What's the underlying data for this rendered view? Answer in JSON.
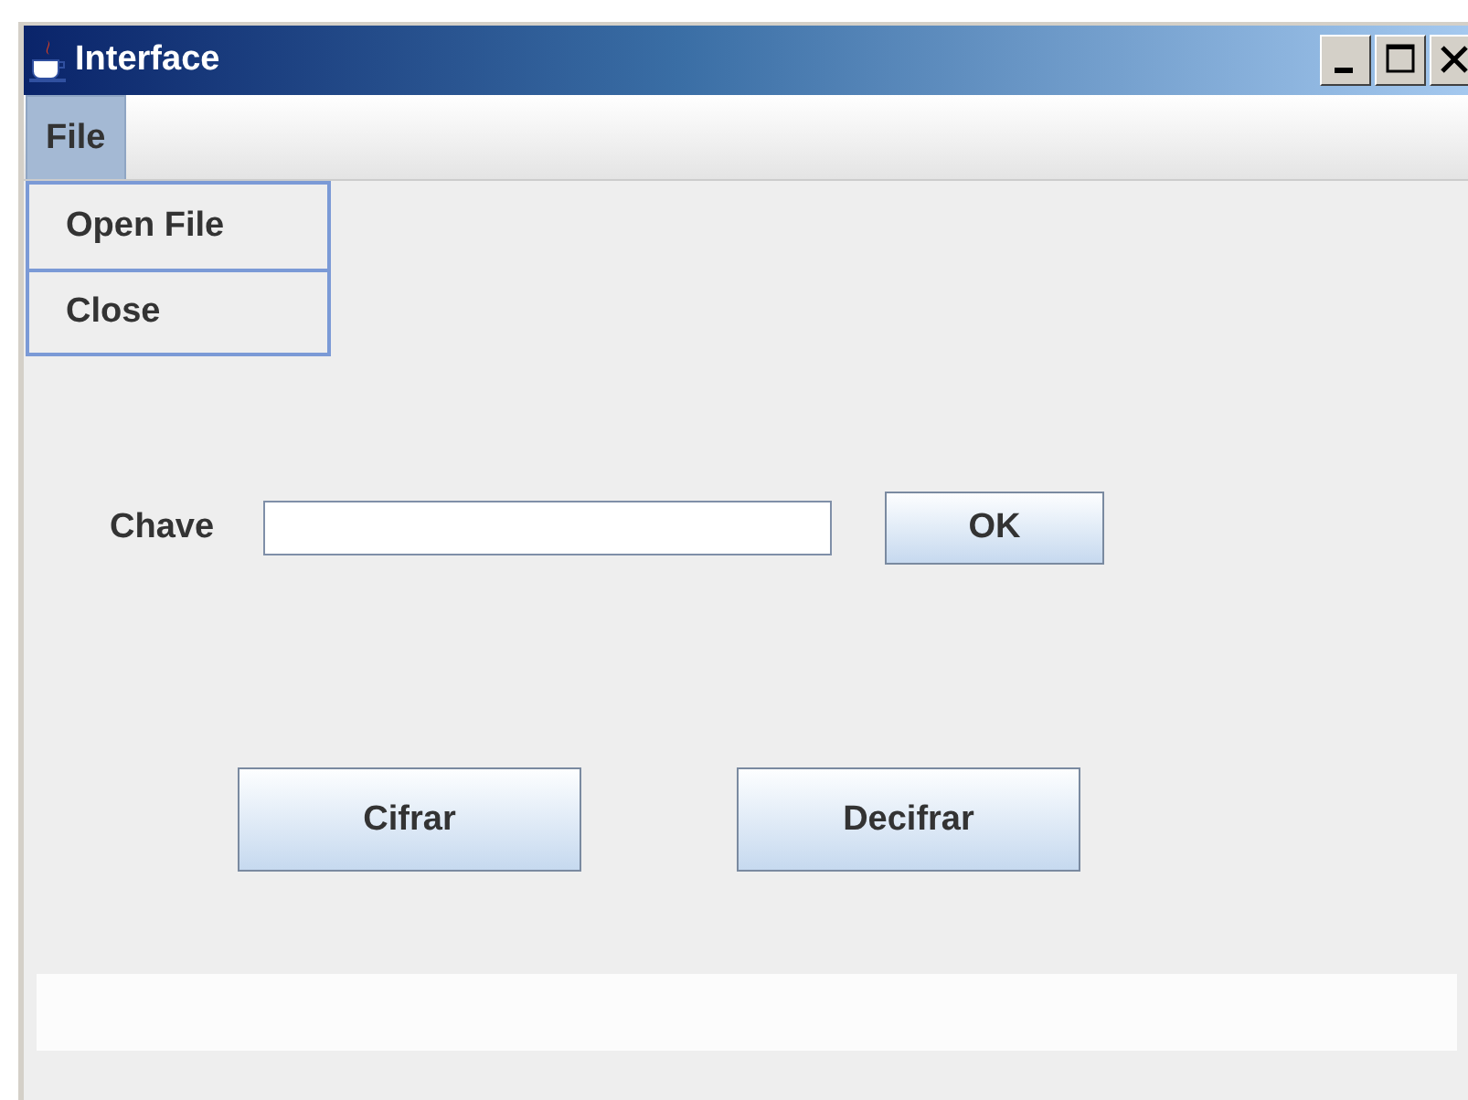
{
  "window": {
    "title": "Interface"
  },
  "menu_bar": [
    {
      "label": "File",
      "selected": true,
      "items": [
        {
          "label": "Open File"
        },
        {
          "label": "Close"
        }
      ]
    }
  ],
  "key_row": {
    "label": "Chave",
    "button": "OK"
  },
  "buttons": [
    "Cifrar",
    "Decifrar"
  ]
}
